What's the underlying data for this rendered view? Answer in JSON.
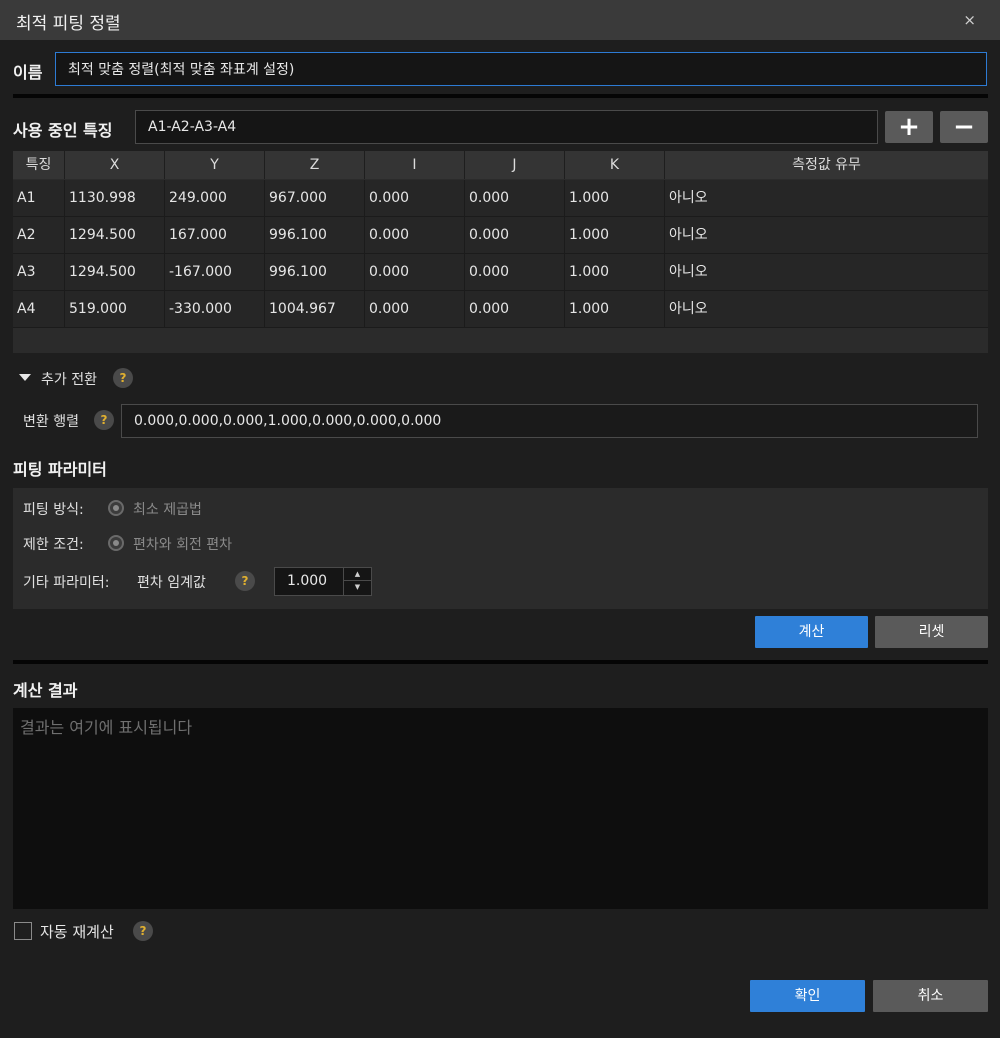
{
  "window": {
    "title": "최적 피팅 정렬",
    "close_glyph": "×"
  },
  "name": {
    "label": "이름",
    "value": "최적 맞춤 정렬(최적 맞춤 좌표계 설정)"
  },
  "features": {
    "label": "사용 중인 특징",
    "value": "A1-A2-A3-A4",
    "add_glyph": "+",
    "remove_glyph": "−",
    "columns": [
      "특징",
      "X",
      "Y",
      "Z",
      "I",
      "J",
      "K",
      "측정값 유무"
    ],
    "rows": [
      [
        "A1",
        "1130.998",
        "249.000",
        "967.000",
        "0.000",
        "0.000",
        "1.000",
        "아니오"
      ],
      [
        "A2",
        "1294.500",
        "167.000",
        "996.100",
        "0.000",
        "0.000",
        "1.000",
        "아니오"
      ],
      [
        "A3",
        "1294.500",
        "-167.000",
        "996.100",
        "0.000",
        "0.000",
        "1.000",
        "아니오"
      ],
      [
        "A4",
        "519.000",
        "-330.000",
        "1004.967",
        "0.000",
        "0.000",
        "1.000",
        "아니오"
      ]
    ]
  },
  "extra_transform": {
    "label": "추가 전환",
    "help": "?",
    "matrix_label": "변환 행렬",
    "matrix_value": "0.000,0.000,0.000,1.000,0.000,0.000,0.000"
  },
  "fitting": {
    "title": "피팅 파라미터",
    "method_label": "피팅 방식:",
    "method_value": "최소 제곱법",
    "constraint_label": "제한 조건:",
    "constraint_value": "편차와 회전 편차",
    "other_label": "기타 파라미터:",
    "threshold_label": "편차 임계값",
    "threshold_value": "1.000",
    "help": "?",
    "spin_up": "▲",
    "spin_down": "▼"
  },
  "actions": {
    "calculate": "계산",
    "reset": "리셋"
  },
  "result": {
    "title": "계산 결과",
    "placeholder": "결과는 여기에 표시됩니다"
  },
  "auto_recalc": {
    "label": "자동 재계산",
    "help": "?"
  },
  "footer": {
    "ok": "확인",
    "cancel": "취소"
  },
  "colors": {
    "accent": "#2f80d8",
    "help": "#e0b030"
  }
}
